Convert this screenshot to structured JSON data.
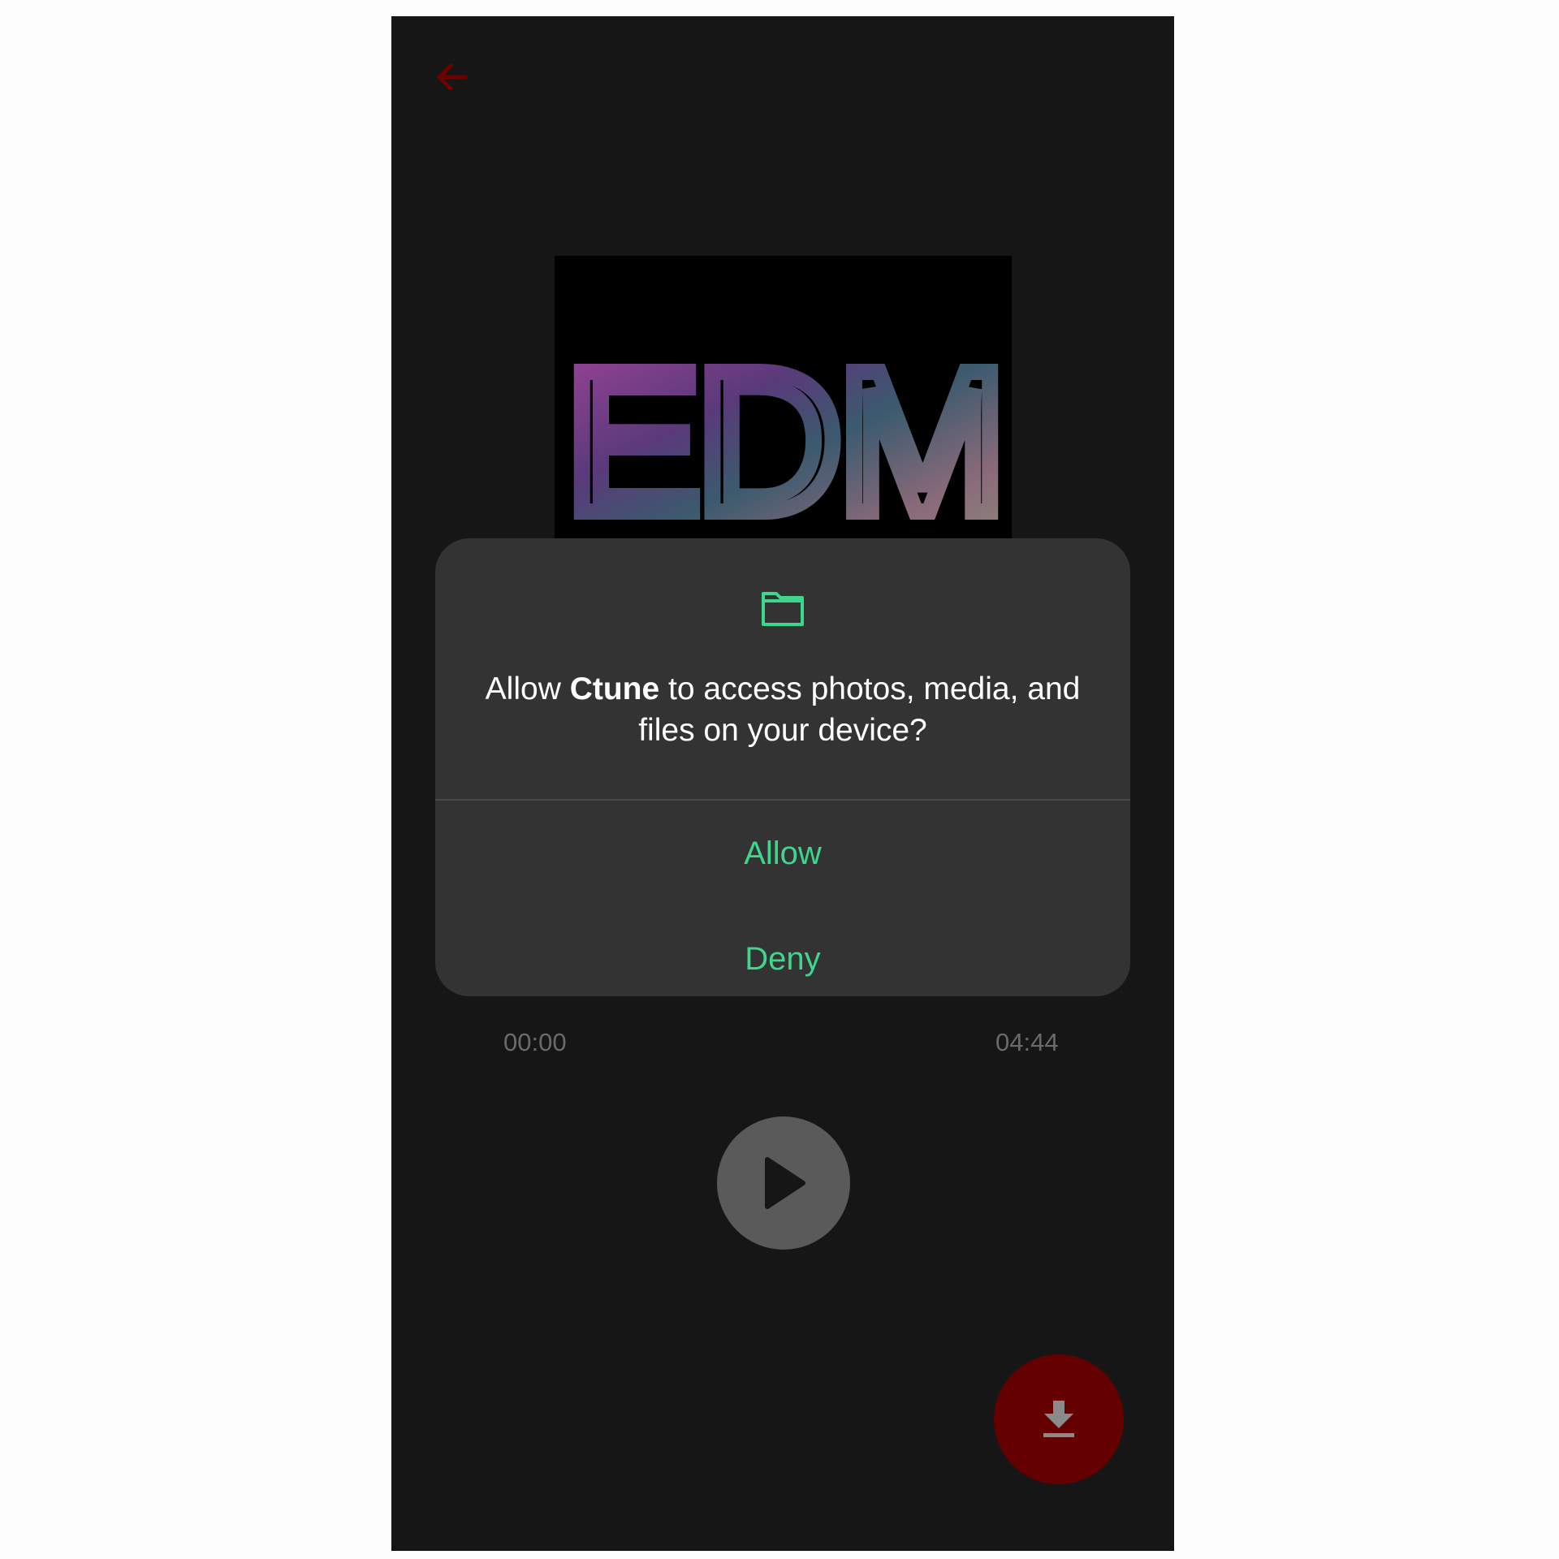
{
  "player": {
    "album_art_text": "EDM",
    "time_current": "00:00",
    "time_total": "04:44",
    "icons": {
      "back": "arrow-left-icon",
      "play": "play-icon",
      "download": "download-icon"
    }
  },
  "dialog": {
    "icon": "folder-icon",
    "message_prefix": "Allow ",
    "app_name": "Ctune",
    "message_suffix": " to access photos, media, and files on your device?",
    "allow_label": "Allow",
    "deny_label": "Deny"
  },
  "colors": {
    "background": "#161616",
    "dialog_background": "#333333",
    "accent_green": "#3dd68c",
    "accent_red": "#650000",
    "back_arrow": "#6e0000"
  }
}
